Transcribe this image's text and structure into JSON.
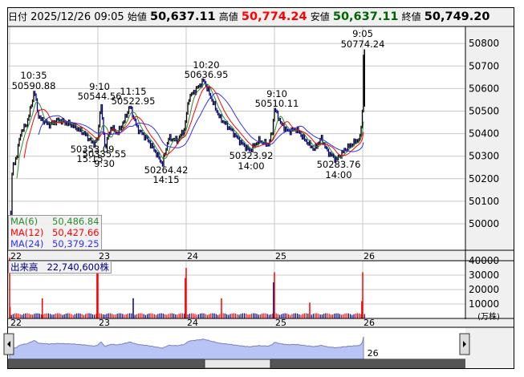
{
  "header": {
    "date_label": "日付",
    "date": "2025/12/26 09:05",
    "open_label": "始値",
    "open": "50,637.11",
    "high_label": "高値",
    "high": "50,774.24",
    "low_label": "安値",
    "low": "50,637.11",
    "close_label": "終値",
    "close": "50,749.20"
  },
  "colors": {
    "up": "#ff0000",
    "down": "#000080",
    "ma6": "#2e8b2e",
    "ma12": "#ff0000",
    "ma24": "#3030ff",
    "high": "#ff0000",
    "low": "#006400",
    "nav_fill": "#b8c4f4"
  },
  "chart_data": {
    "type": "candlestick",
    "y_ticks": [
      50000,
      50100,
      50200,
      50300,
      50400,
      50500,
      50600,
      50700,
      50800
    ],
    "ylim": [
      49900,
      50850
    ],
    "x_days": [
      "22",
      "23",
      "24",
      "25",
      "26"
    ],
    "price_path": [
      [
        22.0,
        50050
      ],
      [
        22.01,
        49980
      ],
      [
        22.03,
        50250
      ],
      [
        22.08,
        50300
      ],
      [
        22.12,
        50400
      ],
      [
        22.2,
        50450
      ],
      [
        22.28,
        50590
      ],
      [
        22.33,
        50470
      ],
      [
        22.45,
        50440
      ],
      [
        22.55,
        50460
      ],
      [
        22.7,
        50440
      ],
      [
        22.85,
        50400
      ],
      [
        22.95,
        50353
      ],
      [
        23.0,
        50380
      ],
      [
        23.03,
        50545
      ],
      [
        23.08,
        50336
      ],
      [
        23.15,
        50430
      ],
      [
        23.22,
        50400
      ],
      [
        23.3,
        50460
      ],
      [
        23.36,
        50523
      ],
      [
        23.45,
        50420
      ],
      [
        23.55,
        50380
      ],
      [
        23.65,
        50320
      ],
      [
        23.73,
        50264
      ],
      [
        23.8,
        50380
      ],
      [
        23.9,
        50370
      ],
      [
        23.98,
        50420
      ],
      [
        24.03,
        50560
      ],
      [
        24.12,
        50600
      ],
      [
        24.2,
        50637
      ],
      [
        24.28,
        50560
      ],
      [
        24.38,
        50470
      ],
      [
        24.5,
        50420
      ],
      [
        24.62,
        50360
      ],
      [
        24.72,
        50324
      ],
      [
        24.82,
        50370
      ],
      [
        24.93,
        50350
      ],
      [
        24.97,
        50400
      ],
      [
        25.0,
        50510
      ],
      [
        25.08,
        50440
      ],
      [
        25.15,
        50410
      ],
      [
        25.25,
        50420
      ],
      [
        25.35,
        50370
      ],
      [
        25.45,
        50330
      ],
      [
        25.53,
        50380
      ],
      [
        25.6,
        50320
      ],
      [
        25.7,
        50284
      ],
      [
        25.8,
        50330
      ],
      [
        25.9,
        50360
      ],
      [
        25.97,
        50380
      ],
      [
        26.0,
        50520
      ],
      [
        26.01,
        50774
      ],
      [
        26.02,
        50749
      ]
    ],
    "annotations": [
      {
        "time": "10:35",
        "value": "50590.88"
      },
      {
        "time": "9:10",
        "value": "50544.56"
      },
      {
        "time": "11:15",
        "value": "50522.95"
      },
      {
        "time": "10:20",
        "value": "50636.95"
      },
      {
        "time": "9:10",
        "value": "50510.11"
      },
      {
        "time": "9:05",
        "value": "50774.24"
      },
      {
        "time": "15:15",
        "value": "50353.09"
      },
      {
        "time": "9:30",
        "value": "50335.55"
      },
      {
        "time": "14:15",
        "value": "50264.42"
      },
      {
        "time": "14:00",
        "value": "50323.92"
      },
      {
        "time": "14:00",
        "value": "50283.76"
      }
    ],
    "ma": [
      {
        "name": "MA(6)",
        "value": "50,486.84"
      },
      {
        "name": "MA(12)",
        "value": "50,427.66"
      },
      {
        "name": "MA(24)",
        "value": "50,379.25"
      }
    ],
    "volume": {
      "label": "出来高",
      "value": "22,740,600株",
      "y_ticks": [
        10000,
        20000,
        30000,
        40000
      ],
      "unit": "(万株)",
      "base": 3000,
      "spikes": [
        [
          22.0,
          42000,
          "up"
        ],
        [
          22.005,
          8000,
          "up"
        ],
        [
          22.37,
          14000,
          "up"
        ],
        [
          22.99,
          32000,
          "up"
        ],
        [
          23.0,
          37000,
          "up"
        ],
        [
          23.4,
          14000,
          "down"
        ],
        [
          23.99,
          28000,
          "up"
        ],
        [
          24.0,
          35000,
          "up"
        ],
        [
          24.4,
          14000,
          "up"
        ],
        [
          24.99,
          25000,
          "down"
        ],
        [
          25.0,
          32000,
          "up"
        ],
        [
          25.4,
          11000,
          "up"
        ],
        [
          25.99,
          12000,
          "up"
        ],
        [
          26.0,
          32000,
          "up"
        ]
      ]
    }
  }
}
